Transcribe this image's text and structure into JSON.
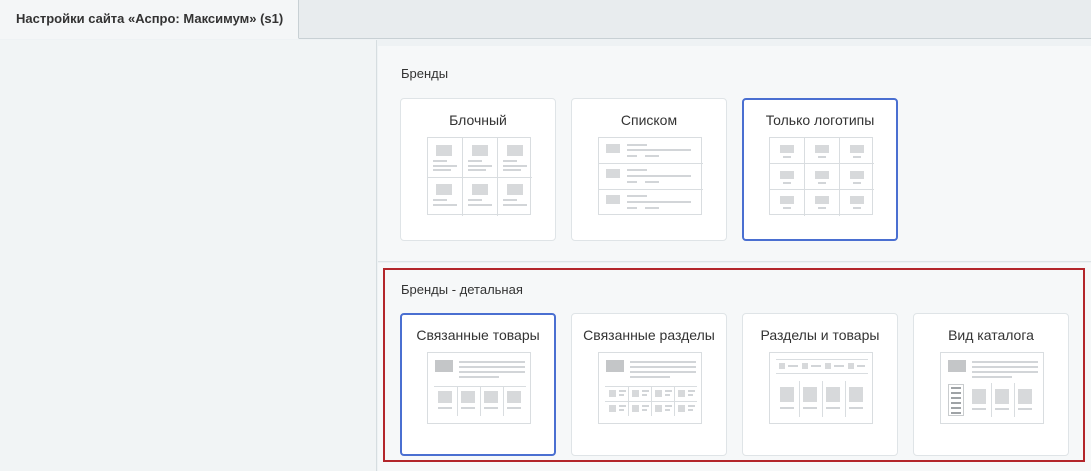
{
  "window": {
    "tab_title": "Настройки сайта «Аспро: Максимум» (s1)"
  },
  "sections": [
    {
      "title": "Бренды",
      "options": [
        {
          "label": "Блочный",
          "selected": false,
          "preview_icon": "grid-3x2-icon"
        },
        {
          "label": "Списком",
          "selected": false,
          "preview_icon": "list-rows-icon"
        },
        {
          "label": "Только логотипы",
          "selected": true,
          "preview_icon": "logo-grid-icon"
        }
      ]
    },
    {
      "title": "Бренды - детальная",
      "options": [
        {
          "label": "Связанные товары",
          "selected": true,
          "preview_icon": "related-products-icon"
        },
        {
          "label": "Связанные разделы",
          "selected": false,
          "preview_icon": "related-sections-icon"
        },
        {
          "label": "Разделы и товары",
          "selected": false,
          "preview_icon": "sections-and-products-icon"
        },
        {
          "label": "Вид каталога",
          "selected": false,
          "preview_icon": "catalog-view-icon"
        }
      ]
    }
  ],
  "colors": {
    "selected_border": "#4a6fd1",
    "highlight_frame": "#b3262b"
  }
}
